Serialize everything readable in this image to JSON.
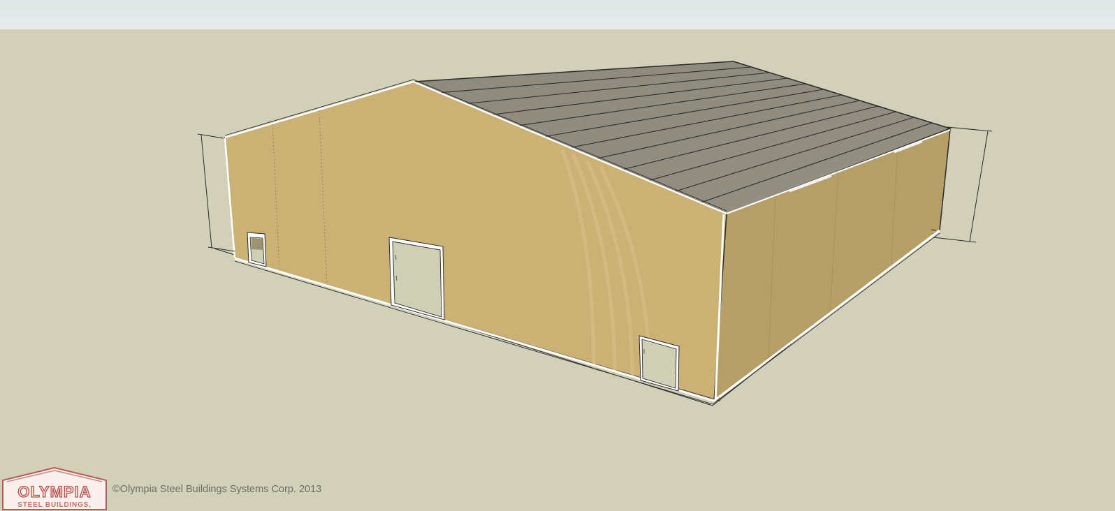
{
  "scene": {
    "subject": "steel building 3D model",
    "colors": {
      "ground": "#d3d0b9",
      "sky": "#e3e9e9",
      "wall_front": "#ccb274",
      "wall_side": "#b69f66",
      "roof": "#908c7e",
      "door": "#cfcfb5",
      "trim": "#ffffff",
      "outline": "#2a2a2a"
    },
    "doors": [
      "walk-door-small",
      "walk-door-large",
      "walk-door-side"
    ],
    "dimension_markers": [
      "height-dimension-left",
      "height-dimension-right"
    ]
  },
  "branding": {
    "logo_name": "OLYMPIA",
    "logo_sub": "STEEL BUILDINGS,",
    "copyright": "©Olympia Steel Buildings Systems Corp. 2013"
  }
}
